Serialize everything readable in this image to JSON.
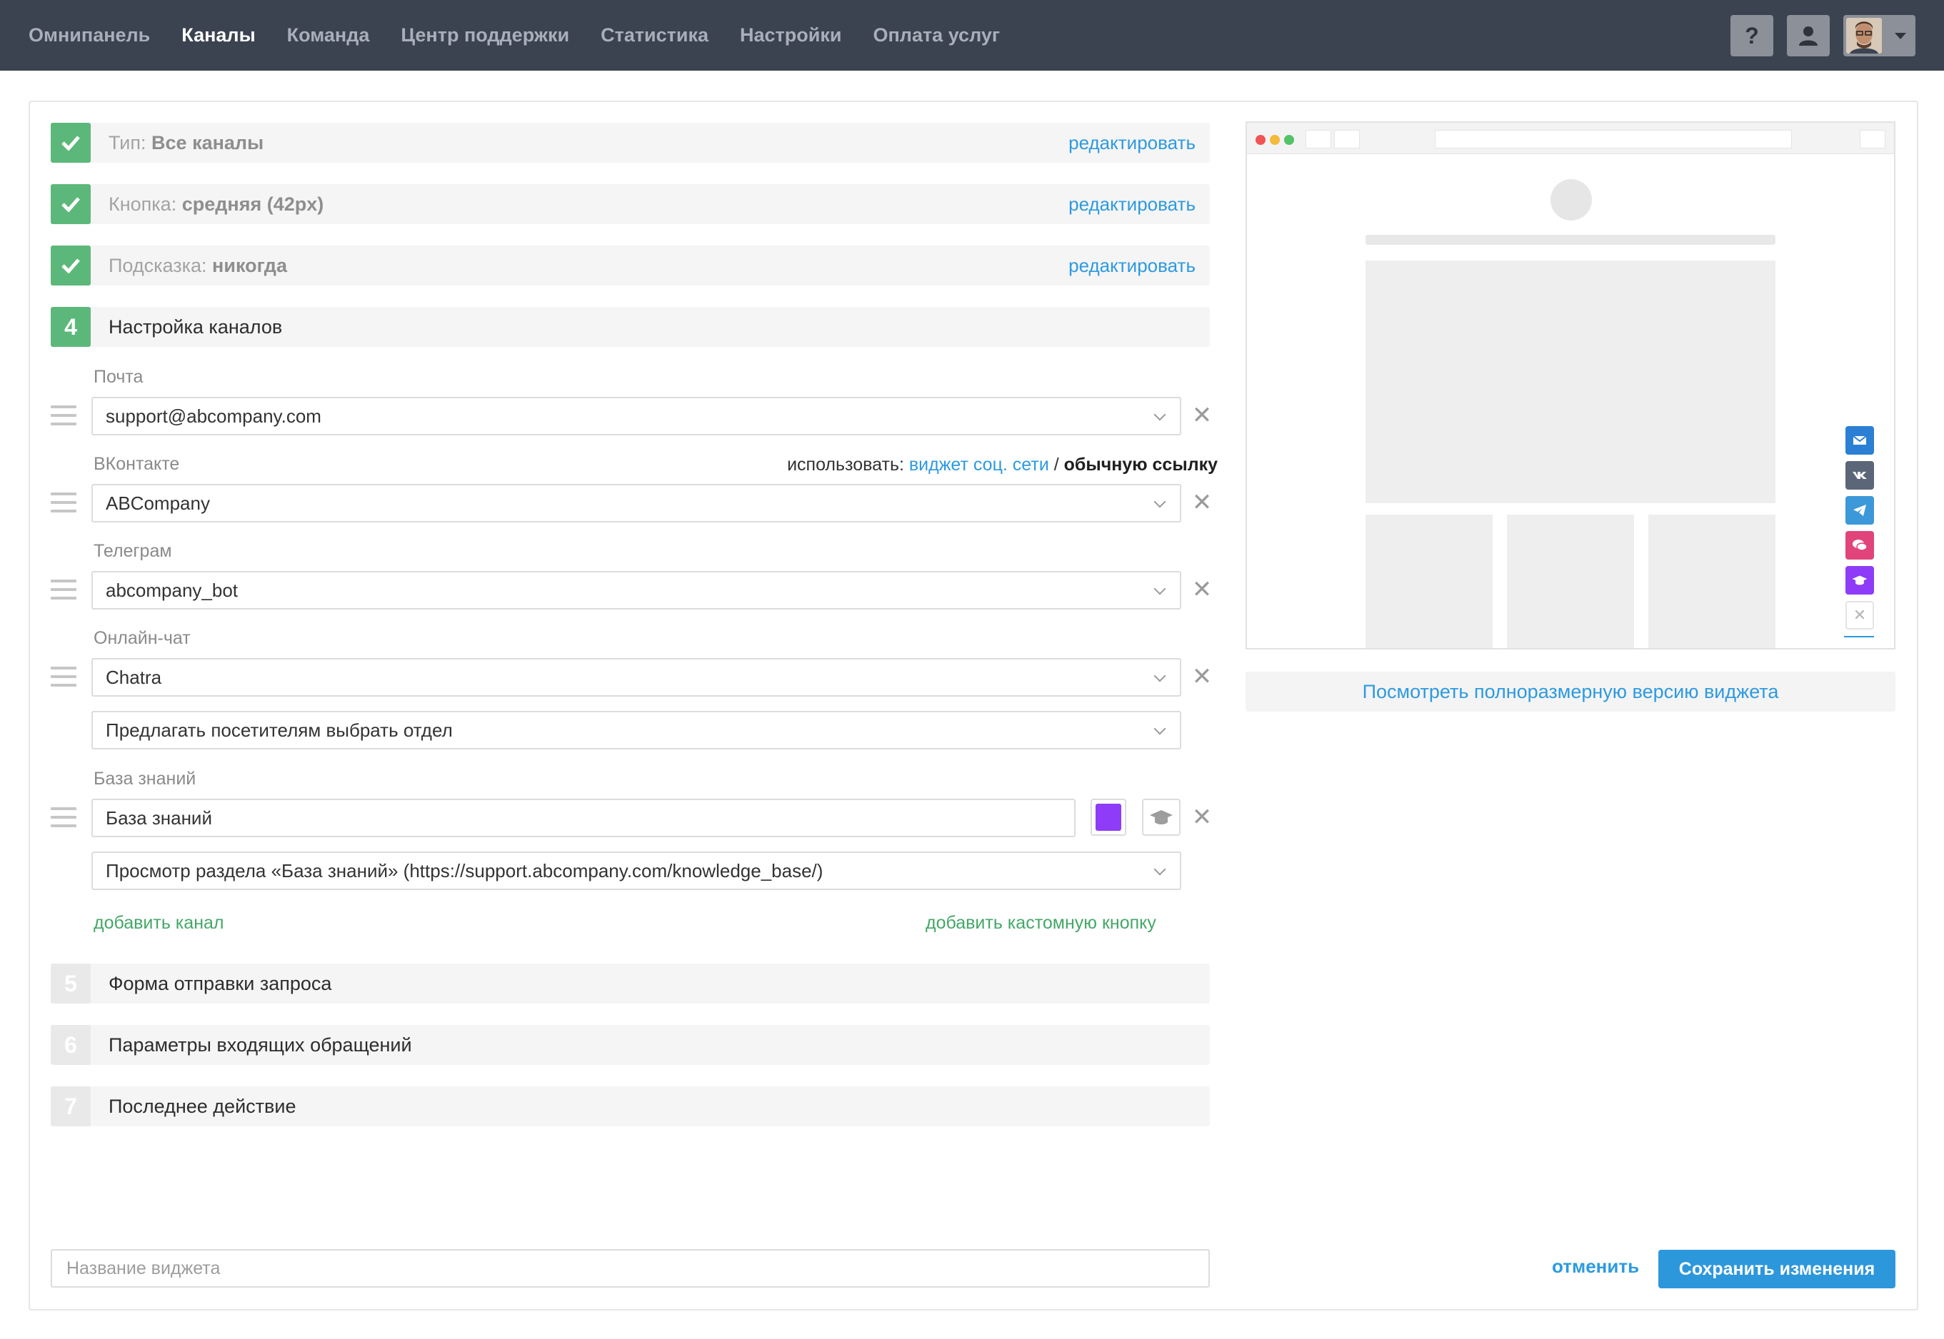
{
  "nav": {
    "items": [
      {
        "label": "Омнипанель",
        "active": false
      },
      {
        "label": "Каналы",
        "active": true
      },
      {
        "label": "Команда",
        "active": false
      },
      {
        "label": "Центр поддержки",
        "active": false
      },
      {
        "label": "Статистика",
        "active": false
      },
      {
        "label": "Настройки",
        "active": false
      },
      {
        "label": "Оплата услуг",
        "active": false
      }
    ],
    "help_label": "?",
    "icons": {
      "help": "question-icon",
      "user": "user-icon",
      "avatar": "avatar-photo"
    }
  },
  "steps": {
    "type": {
      "prefix": "Тип:",
      "value": "Все каналы",
      "edit": "редактировать"
    },
    "button": {
      "prefix": "Кнопка:",
      "value": "средняя (42px)",
      "edit": "редактировать"
    },
    "hint": {
      "prefix": "Подсказка:",
      "value": "никогда",
      "edit": "редактировать"
    },
    "channels": {
      "number": "4",
      "title": "Настройка каналов"
    },
    "form": {
      "number": "5",
      "title": "Форма отправки запроса"
    },
    "incoming": {
      "number": "6",
      "title": "Параметры входящих обращений"
    },
    "last": {
      "number": "7",
      "title": "Последнее действие"
    }
  },
  "channels": {
    "mail": {
      "label": "Почта",
      "value": "support@abcompany.com"
    },
    "vk": {
      "label": "ВКонтакте",
      "value": "ABCompany",
      "use_prefix": "использовать:",
      "use_widget": "виджет соц. сети",
      "use_sep": "/",
      "use_link": "обычную ссылку"
    },
    "telegram": {
      "label": "Телеграм",
      "value": "abcompany_bot"
    },
    "chat": {
      "label": "Онлайн-чат",
      "value": "Chatra",
      "option": "Предлагать посетителям выбрать отдел"
    },
    "kb": {
      "label": "База знаний",
      "value": "База знаний",
      "color": "#8e3cf7",
      "icon": "graduation-cap-icon",
      "option": "Просмотр раздела «База знаний» (https://support.abcompany.com/knowledge_base/)"
    },
    "remove_symbol": "✕",
    "add_channel": "добавить канал",
    "add_custom": "добавить кастомную кнопку"
  },
  "preview": {
    "side_buttons": [
      {
        "icon": "mail-icon",
        "color": "#2b7fd4"
      },
      {
        "icon": "vk-icon",
        "color": "#5b6778"
      },
      {
        "icon": "telegram-icon",
        "color": "#3c98d8"
      },
      {
        "icon": "chat-icon",
        "color": "#e0447a"
      },
      {
        "icon": "knowledge-base-icon",
        "color": "#8e3cf7"
      }
    ],
    "close_symbol": "✕",
    "full_version_link": "Посмотреть полноразмерную версию виджета"
  },
  "footer": {
    "name_placeholder": "Название виджета",
    "cancel": "отменить",
    "save": "Сохранить изменения"
  },
  "colors": {
    "accent": "#2d9ae0",
    "success": "#5cb87a",
    "topbar": "#3b4250",
    "save": "#2d97dc",
    "green_link": "#45a768"
  }
}
